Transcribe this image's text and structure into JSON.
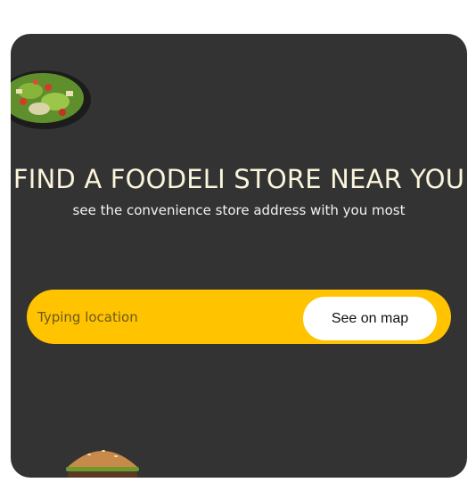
{
  "hero": {
    "title": "FIND A FOODELI STORE NEAR YOU",
    "subtitle": "see the convenience store address with you most"
  },
  "search": {
    "placeholder": "Typing location",
    "value": "",
    "button_label": "See on map"
  },
  "colors": {
    "card_background": "#333333",
    "accent": "#ffc300",
    "title": "#fbf5dc"
  },
  "decorations": [
    "salad-plate-image",
    "burger-image"
  ]
}
